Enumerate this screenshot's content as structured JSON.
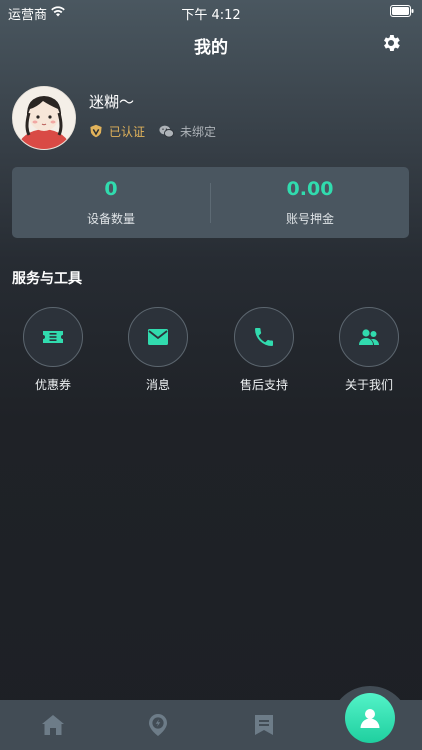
{
  "status_bar": {
    "carrier": "运营商",
    "time": "下午 4:12"
  },
  "header": {
    "title": "我的"
  },
  "profile": {
    "name": "迷糊～",
    "verified_label": "已认证",
    "wechat_label": "未绑定"
  },
  "stats": [
    {
      "value": "0",
      "label": "设备数量"
    },
    {
      "value": "0.00",
      "label": "账号押金"
    }
  ],
  "services": {
    "title": "服务与工具",
    "items": [
      {
        "label": "优惠券",
        "icon": "ticket-icon"
      },
      {
        "label": "消息",
        "icon": "envelope-icon"
      },
      {
        "label": "售后支持",
        "icon": "phone-icon"
      },
      {
        "label": "关于我们",
        "icon": "users-icon"
      }
    ]
  },
  "tabbar": {
    "items": [
      "home-icon",
      "map-pin-bolt-icon",
      "bookmark-list-icon",
      "user-icon"
    ],
    "active_index": 3
  },
  "colors": {
    "accent": "#31dbae",
    "verified": "#e2b35b",
    "card": "#4a5660",
    "tabbar": "#424c55"
  }
}
